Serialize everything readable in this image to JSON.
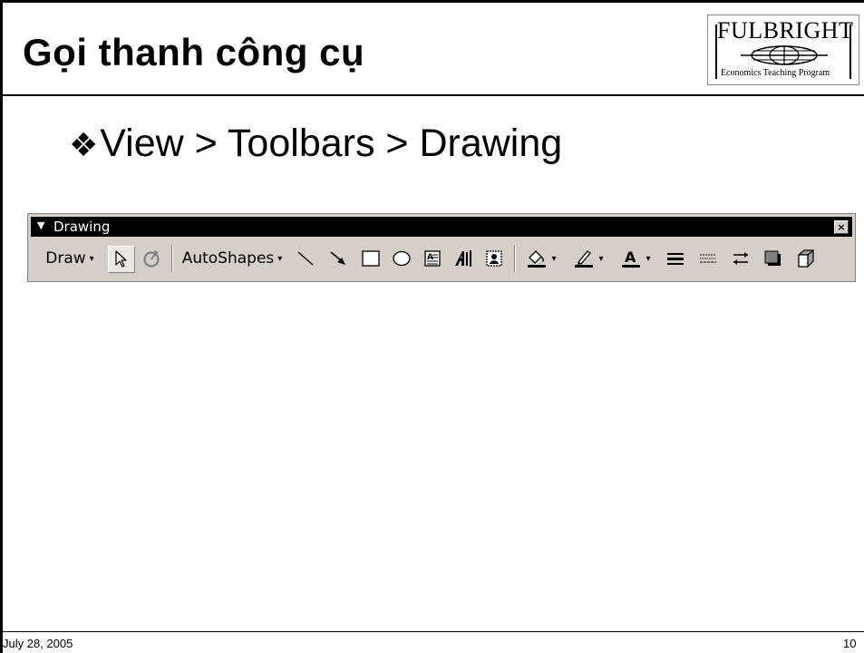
{
  "slide": {
    "title": "Gọi thanh công cụ",
    "bullet_glyph": "❖",
    "bullet_text": "View > Toolbars > Drawing",
    "footer_date": "July 28, 2005",
    "footer_page": "10"
  },
  "logo": {
    "word": "FULBRIGHT",
    "subtitle": "Economics Teaching Program"
  },
  "toolbar": {
    "title": "Drawing",
    "menu_arrow": "▼",
    "close_label": "×",
    "draw_label": "Draw",
    "autoshapes_label": "AutoShapes",
    "dropdown_caret": "▾",
    "icons": [
      "select-objects-icon",
      "free-rotate-icon",
      "line-icon",
      "arrow-icon",
      "rectangle-icon",
      "oval-icon",
      "text-box-icon",
      "wordart-icon",
      "clip-art-icon",
      "fill-color-icon",
      "line-color-icon",
      "font-color-icon",
      "line-style-icon",
      "dash-style-icon",
      "arrow-style-icon",
      "shadow-icon",
      "3d-icon"
    ]
  },
  "colors": {
    "toolbar_face": "#d4d0c8",
    "titlebar": "#000000",
    "fill_color_swatch": "#000000"
  }
}
